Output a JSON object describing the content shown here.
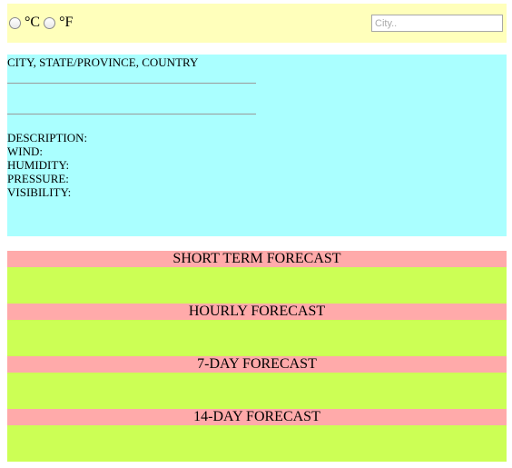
{
  "units": {
    "celsius_label": "°C",
    "fahrenheit_label": "°F"
  },
  "search": {
    "placeholder": "City..",
    "value": ""
  },
  "current": {
    "location": "CITY, STATE/PROVINCE, COUNTRY",
    "description_label": "DESCRIPTION:",
    "wind_label": "WIND:",
    "humidity_label": "HUMIDITY:",
    "pressure_label": "PRESSURE:",
    "visibility_label": "VISIBILITY:"
  },
  "forecasts": {
    "short_term": "SHORT TERM FORECAST",
    "hourly": "HOURLY FORECAST",
    "seven_day": "7-DAY FORECAST",
    "fourteen_day": "14-DAY FORECAST"
  }
}
